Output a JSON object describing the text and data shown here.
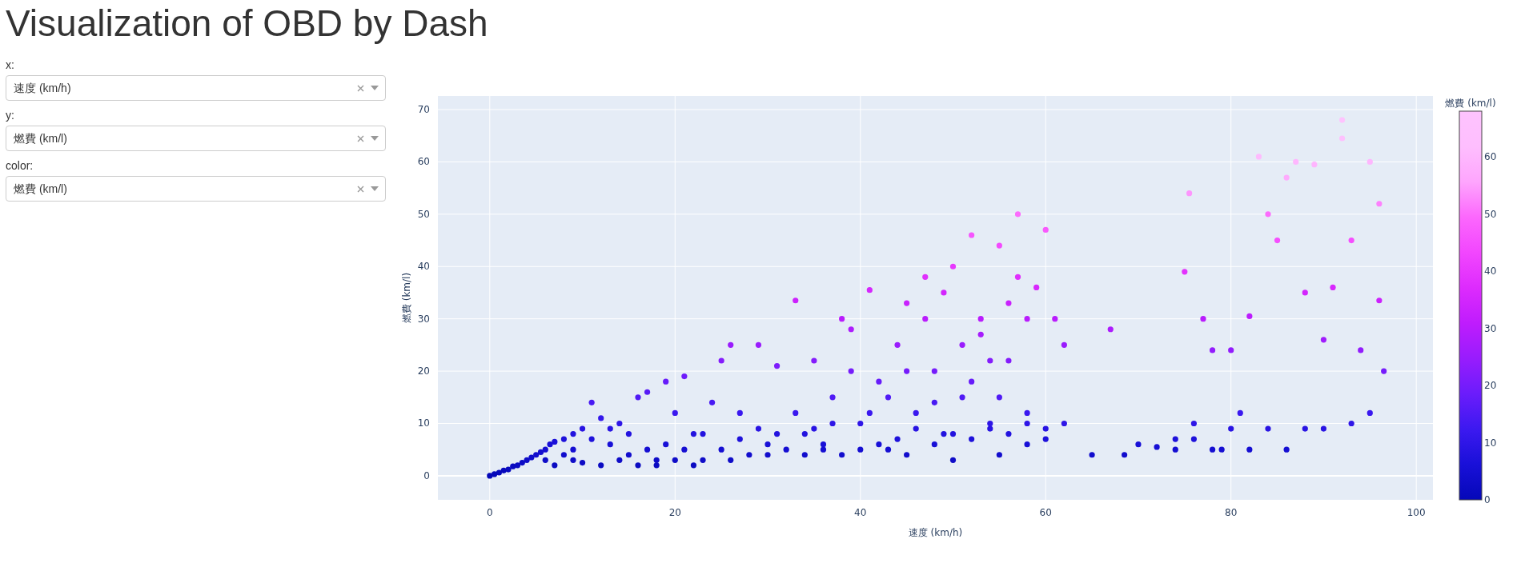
{
  "title": "Visualization of OBD by Dash",
  "controls": [
    {
      "label": "x:",
      "value": "速度 (km/h)"
    },
    {
      "label": "y:",
      "value": "燃費 (km/l)"
    },
    {
      "label": "color:",
      "value": "燃費 (km/l)"
    }
  ],
  "chart": {
    "colorbar_ticks": [
      "60",
      "50",
      "40",
      "30",
      "20",
      "10",
      "0"
    ],
    "chart_data": {
      "type": "scatter",
      "grid": true,
      "xlabel": "速度 (km/h)",
      "ylabel": "燃費 (km/l)",
      "xlim": [
        -5.6,
        101.8
      ],
      "ylim": [
        -4.6,
        72.6
      ],
      "xticks": [
        0,
        20,
        40,
        60,
        80,
        100
      ],
      "yticks": [
        0,
        10,
        20,
        30,
        40,
        50,
        60,
        70
      ],
      "x": [
        0,
        0.5,
        1,
        1.5,
        2,
        2.5,
        3,
        3.5,
        4,
        4.5,
        5,
        5.5,
        6,
        6.5,
        7,
        8,
        9,
        10,
        6,
        7,
        8,
        9,
        10,
        11,
        12,
        13,
        14,
        15,
        16,
        17,
        18,
        19,
        20,
        21,
        22,
        23,
        24,
        25,
        26,
        27,
        28,
        29,
        30,
        31,
        32,
        33,
        34,
        35,
        36,
        37,
        38,
        39,
        40,
        41,
        42,
        43,
        44,
        45,
        46,
        47,
        48,
        49,
        50,
        51,
        52,
        53,
        54,
        55,
        56,
        57,
        58,
        59,
        60,
        61,
        62,
        42,
        44,
        46,
        48,
        50,
        52,
        54,
        56,
        58,
        60,
        40,
        38,
        36,
        34,
        30,
        26,
        22,
        20,
        18,
        16,
        14,
        12,
        65,
        67,
        68.5,
        70,
        72,
        74,
        75,
        75.5,
        76,
        77,
        78,
        79,
        80,
        81,
        82,
        83,
        84,
        85,
        86,
        87,
        88,
        89,
        90,
        91,
        92,
        93,
        94,
        95,
        96,
        96.5,
        96,
        95,
        93,
        90,
        88,
        86,
        84,
        82,
        80,
        78,
        76,
        74,
        92,
        57,
        56,
        55,
        53,
        51,
        49,
        47,
        45,
        43,
        41,
        39,
        37,
        35,
        33,
        31,
        29,
        27,
        25,
        23,
        21,
        19,
        17,
        15,
        13,
        11,
        9,
        45,
        50,
        55,
        58,
        60,
        62,
        48,
        52,
        54,
        58
      ],
      "series": [
        {
          "name": "燃費 (km/l)",
          "values": [
            0,
            0.3,
            0.6,
            1,
            1.2,
            1.8,
            2,
            2.5,
            3,
            3.5,
            4,
            4.5,
            5,
            6,
            6.5,
            7,
            8,
            9,
            3,
            2,
            4,
            3,
            2.5,
            14,
            11,
            6,
            10,
            4,
            15,
            16,
            3,
            18,
            12,
            19,
            8,
            3,
            14,
            22,
            25,
            12,
            4,
            25,
            6,
            21,
            5,
            33.5,
            8,
            22,
            5,
            15,
            30,
            28,
            10,
            35.5,
            18,
            5,
            25,
            33,
            12,
            38,
            20,
            8,
            40,
            15,
            46,
            27,
            10,
            44,
            33,
            50,
            12,
            36,
            47,
            30,
            25,
            6,
            7,
            9,
            6,
            8,
            7,
            9,
            8,
            10,
            7,
            5,
            4,
            6,
            4,
            4,
            3,
            2,
            3,
            2,
            2,
            3,
            2,
            4,
            28,
            4,
            6,
            5.5,
            5,
            39,
            54,
            10,
            30,
            24,
            5,
            24,
            12,
            30.5,
            61,
            50,
            45,
            57,
            60,
            35,
            59.5,
            26,
            36,
            68,
            45,
            24,
            60,
            52,
            20,
            33.5,
            12,
            10,
            9,
            9,
            5,
            9,
            5,
            9,
            5,
            7,
            7,
            64.5,
            38,
            22,
            15,
            30,
            25,
            35,
            30,
            20,
            15,
            12,
            20,
            10,
            9,
            12,
            8,
            9,
            7,
            5,
            8,
            5,
            6,
            5,
            8,
            9,
            7,
            5,
            4,
            3,
            4,
            6,
            9,
            10,
            14,
            18,
            22,
            30
          ]
        }
      ]
    }
  }
}
